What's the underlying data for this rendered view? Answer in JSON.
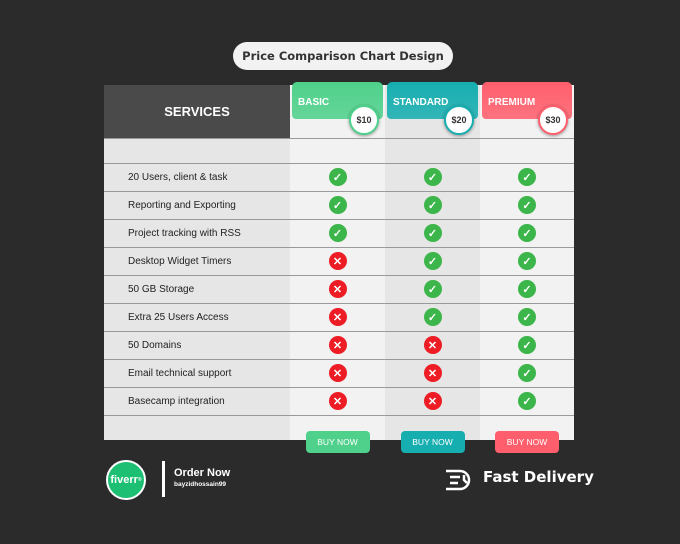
{
  "title": "Price Comparison Chart Design",
  "services_header": "SERVICES",
  "plans": [
    {
      "name": "BASIC",
      "price": "$10",
      "color": "#4fd18b",
      "button": "BUY NOW",
      "features": [
        true,
        true,
        true,
        false,
        false,
        false,
        false,
        false,
        false
      ]
    },
    {
      "name": "STANDARD",
      "price": "$20",
      "color": "#17aeb0",
      "button": "BUY NOW",
      "features": [
        true,
        true,
        true,
        true,
        true,
        true,
        false,
        false,
        false
      ]
    },
    {
      "name": "PREMIUM",
      "price": "$30",
      "color": "#ff5f6d",
      "button": "BUY NOW",
      "features": [
        true,
        true,
        true,
        true,
        true,
        true,
        true,
        true,
        true
      ]
    }
  ],
  "services": [
    "20 Users, client & task",
    "Reporting and Exporting",
    "Project tracking with RSS",
    "Desktop Widget Timers",
    "50 GB Storage",
    "Extra 25 Users Access",
    "50 Domains",
    "Email technical support",
    "Basecamp integration"
  ],
  "icons": {
    "yes": "check-circle-icon",
    "no": "x-circle-icon",
    "yes_color": "#3cb54a",
    "no_color": "#ee1c24"
  },
  "footer": {
    "logo": "fiverr",
    "order": "Order Now",
    "username": "bayzidhossain99",
    "delivery": "Fast Delivery"
  }
}
